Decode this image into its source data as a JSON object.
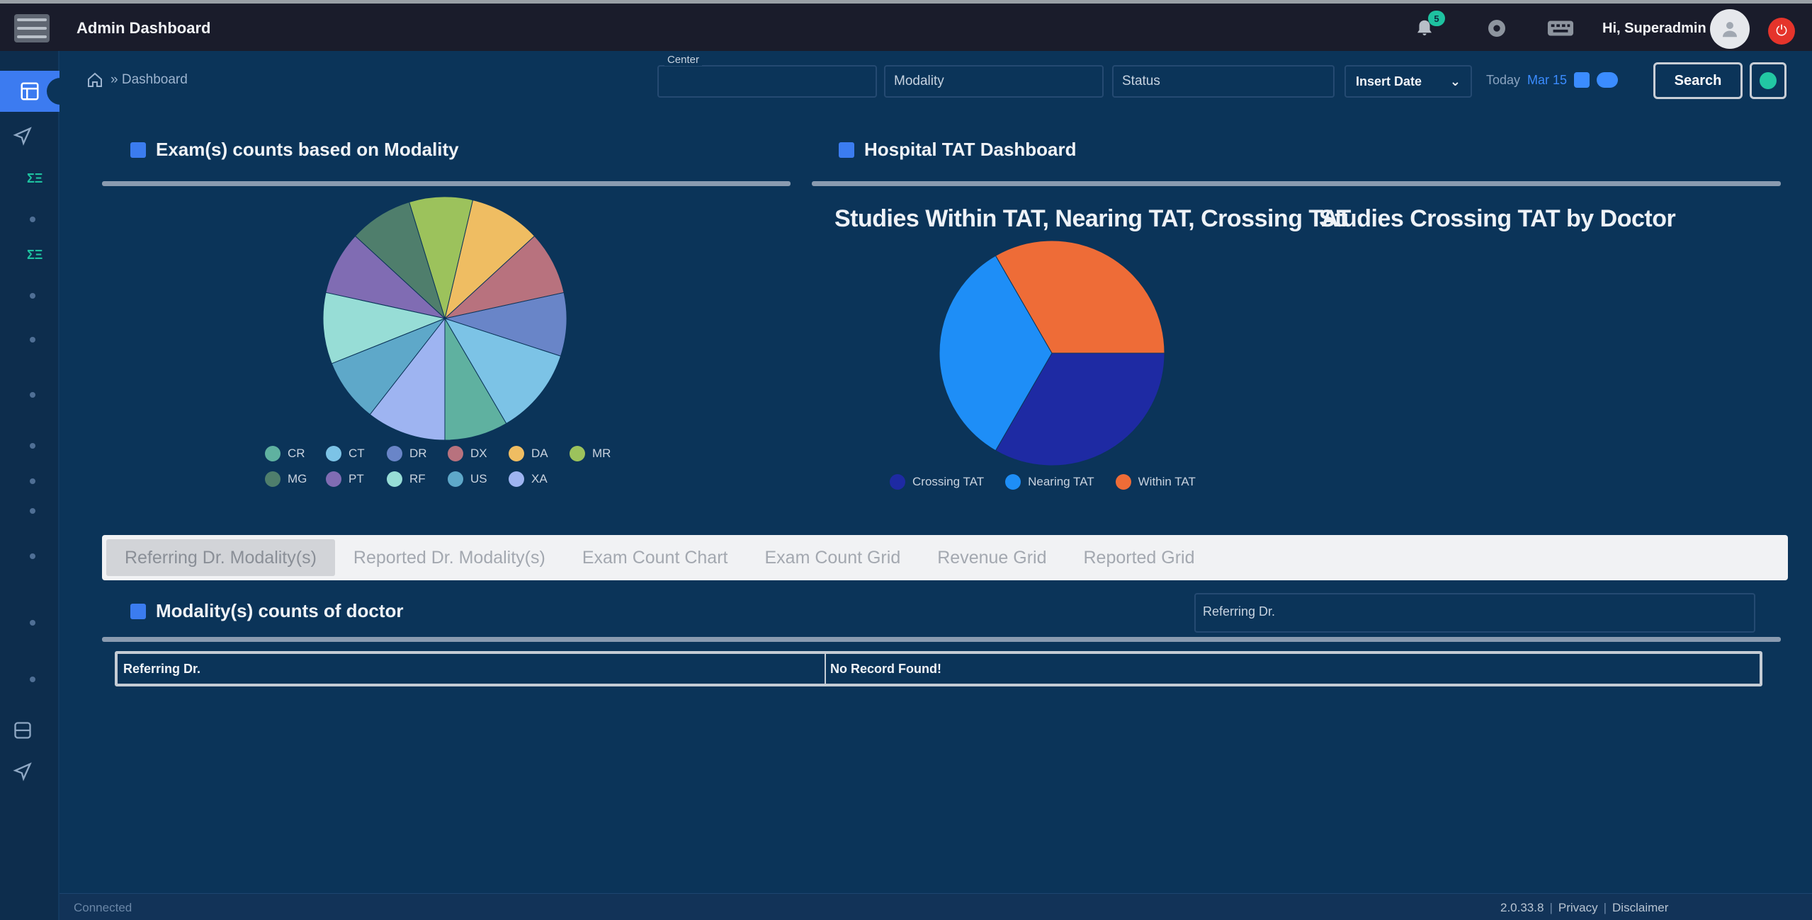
{
  "header": {
    "title": "Admin Dashboard",
    "notification_count": "5",
    "greeting": "Hi, Superadmin"
  },
  "breadcrumb": {
    "label": "» Dashboard"
  },
  "filters": {
    "caption": "Center",
    "center_placeholder": "",
    "modality_placeholder": "Modality",
    "status_placeholder": "Status",
    "date_type": "Insert Date",
    "today_label": "Today",
    "today_date": "Mar 15",
    "search_label": "Search"
  },
  "sections": {
    "exam_counts": "Exam(s) counts based on Modality",
    "hospital_tat": "Hospital TAT Dashboard",
    "modality_counts_doctor": "Modality(s) counts of doctor"
  },
  "charts_titles": {
    "tat_pie": "Studies Within TAT, Nearing TAT, Crossing TAT",
    "doctor_tat": "Studies Crossing TAT by Doctor"
  },
  "chart_data": [
    {
      "type": "pie",
      "title": "",
      "categories": [
        "CR",
        "CT",
        "DR",
        "DX",
        "DA",
        "MR",
        "MG",
        "PT",
        "RF",
        "US",
        "XA"
      ],
      "values": [
        8,
        11,
        8,
        8,
        9,
        8,
        8,
        8,
        9,
        8,
        10
      ],
      "colors": [
        "#5fb1a0",
        "#7cc3e6",
        "#6985c8",
        "#b8727e",
        "#efbd62",
        "#9cc25c",
        "#4f7e6c",
        "#806cb3",
        "#97ddd6",
        "#5ea8c9",
        "#9eb4f1"
      ],
      "legend_position": "bottom"
    },
    {
      "type": "pie",
      "title": "Studies Within TAT, Nearing TAT, Crossing TAT",
      "categories": [
        "Crossing TAT",
        "Nearing TAT",
        "Within TAT"
      ],
      "values": [
        1,
        1,
        1
      ],
      "colors": [
        "#1e2aa3",
        "#1e8ef7",
        "#ee6c37"
      ],
      "legend_position": "bottom"
    }
  ],
  "tabs": [
    {
      "label": "Referring Dr. Modality(s)",
      "active": true
    },
    {
      "label": "Reported Dr. Modality(s)",
      "active": false
    },
    {
      "label": "Exam Count Chart",
      "active": false
    },
    {
      "label": "Exam Count Grid",
      "active": false
    },
    {
      "label": "Revenue Grid",
      "active": false
    },
    {
      "label": "Reported Grid",
      "active": false
    }
  ],
  "referring_filter": {
    "placeholder": "Referring Dr."
  },
  "grid": {
    "col1_header": "Referring Dr.",
    "empty_text": "No Record Found!"
  },
  "footer": {
    "left": "Connected",
    "version": "2.0.33.8",
    "privacy": "Privacy",
    "disclaimer": "Disclaimer"
  },
  "icons": {
    "menu": "hamburger-icon",
    "bell": "bell-icon",
    "settings": "gear-icon",
    "keyboard": "keyboard-icon",
    "home": "home-icon",
    "power": "power-icon"
  }
}
